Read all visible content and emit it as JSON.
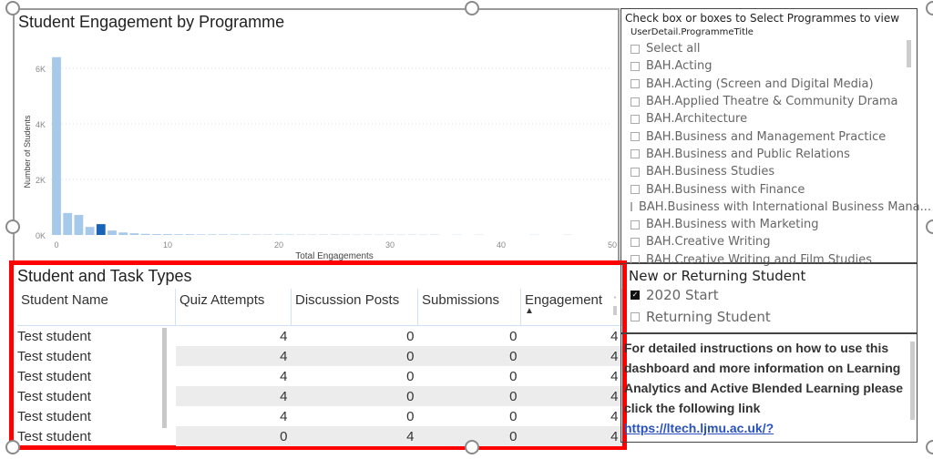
{
  "chart": {
    "title": "Student Engagement by Programme",
    "chart_data": {
      "type": "bar",
      "xlabel": "Total Engagements",
      "ylabel": "Number of Students",
      "x_ticks": [
        "0",
        "10",
        "20",
        "30",
        "40",
        "50"
      ],
      "y_ticks": [
        "0K",
        "2K",
        "4K",
        "6K"
      ],
      "xlim": [
        0,
        50
      ],
      "ylim": [
        0,
        6500
      ],
      "grid": true,
      "highlighted_x": 4,
      "colors": {
        "bar": "#a6c8ea",
        "highlight": "#1a64b8"
      },
      "x": [
        0,
        1,
        2,
        3,
        4,
        5,
        6,
        7,
        8,
        9,
        10,
        11,
        12,
        13,
        14,
        15,
        16,
        17,
        18,
        19,
        20,
        21,
        22,
        23,
        24,
        25,
        26,
        27,
        28,
        29,
        30,
        31,
        32,
        33,
        34,
        36,
        38,
        43,
        46
      ],
      "values": [
        6400,
        790,
        720,
        290,
        390,
        160,
        90,
        60,
        40,
        30,
        30,
        25,
        25,
        20,
        20,
        20,
        18,
        18,
        15,
        15,
        15,
        15,
        12,
        12,
        12,
        12,
        10,
        10,
        10,
        10,
        10,
        10,
        10,
        10,
        10,
        8,
        8,
        8,
        8
      ]
    }
  },
  "slicer": {
    "heading": "Check box or boxes to Select Programmes to view",
    "field": "UserDetail.ProgrammeTitle",
    "items": [
      "Select all",
      "BAH.Acting",
      "BAH.Acting (Screen and Digital Media)",
      "BAH.Applied Theatre & Community Drama",
      "BAH.Architecture",
      "BAH.Business and Management Practice",
      "BAH.Business and Public Relations",
      "BAH.Business Studies",
      "BAH.Business with Finance",
      "BAH.Business with International Business Mana...",
      "BAH.Business with Marketing",
      "BAH.Creative Writing",
      "BAH.Creative Writing and Film Studies"
    ]
  },
  "table": {
    "title": "Student and Task Types",
    "columns": [
      "Student Name",
      "Quiz Attempts",
      "Discussion Posts",
      "Submissions",
      "Engagement"
    ],
    "sort_indicator": "▲",
    "rows": [
      [
        "Test student",
        "4",
        "0",
        "0",
        "4"
      ],
      [
        "Test student",
        "4",
        "0",
        "0",
        "4"
      ],
      [
        "Test student",
        "4",
        "0",
        "0",
        "4"
      ],
      [
        "Test student",
        "4",
        "0",
        "0",
        "4"
      ],
      [
        "Test student",
        "4",
        "0",
        "0",
        "4"
      ],
      [
        "Test student",
        "0",
        "4",
        "0",
        "4"
      ]
    ]
  },
  "new_returning": {
    "title": "New or Returning Student",
    "options": [
      {
        "label": "2020 Start",
        "checked": true
      },
      {
        "label": "Returning Student",
        "checked": false
      }
    ]
  },
  "info": {
    "text": "For detailed instructions on how to use this dashboard and more information on Learning Analytics and Active Blended Learning please click the following link ",
    "link": "https://ltech.ljmu.ac.uk/?"
  }
}
